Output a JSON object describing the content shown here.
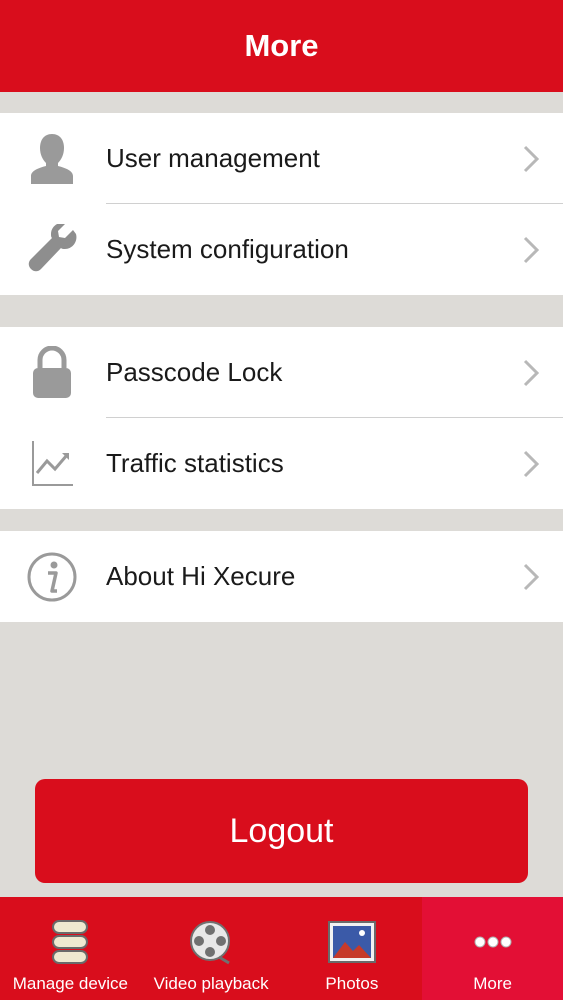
{
  "header": {
    "title": "More"
  },
  "groups": [
    {
      "items": [
        {
          "label": "User management",
          "icon": "user-icon"
        },
        {
          "label": "System configuration",
          "icon": "wrench-icon"
        }
      ]
    },
    {
      "items": [
        {
          "label": "Passcode Lock",
          "icon": "lock-icon"
        },
        {
          "label": "Traffic statistics",
          "icon": "chart-icon"
        }
      ]
    },
    {
      "items": [
        {
          "label": "About Hi Xecure",
          "icon": "info-icon"
        }
      ]
    }
  ],
  "logout": {
    "label": "Logout"
  },
  "tabbar": {
    "tabs": [
      {
        "label": "Manage device",
        "icon": "stack-icon",
        "active": false
      },
      {
        "label": "Video playback",
        "icon": "film-reel-icon",
        "active": false
      },
      {
        "label": "Photos",
        "icon": "photo-icon",
        "active": false
      },
      {
        "label": "More",
        "icon": "dots-icon",
        "active": true
      }
    ]
  },
  "colors": {
    "brand": "#d90d1c",
    "background": "#dddbd7",
    "active_tab": "#e30f35"
  }
}
